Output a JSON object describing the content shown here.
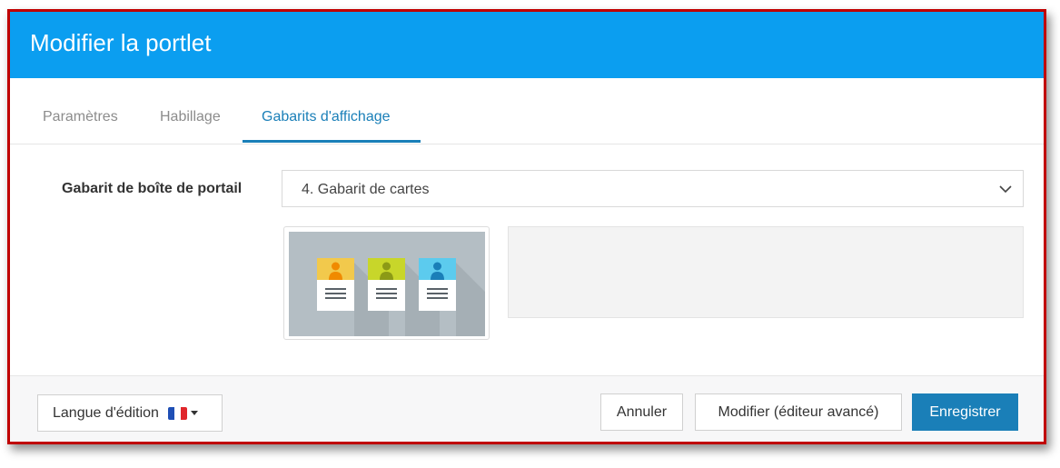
{
  "dialog": {
    "title": "Modifier la portlet"
  },
  "tabs": [
    {
      "label": "Paramètres"
    },
    {
      "label": "Habillage"
    },
    {
      "label": "Gabarits d'affichage"
    }
  ],
  "active_tab": "Gabarits d'affichage",
  "form": {
    "label": "Gabarit de boîte de portail",
    "selected": "4. Gabarit de cartes"
  },
  "footer": {
    "language_label": "Langue d'édition",
    "cancel_label": "Annuler",
    "advanced_label": "Modifier (éditeur avancé)",
    "save_label": "Enregistrer"
  },
  "colors": {
    "header": "#0b9ef0",
    "accent": "#1a7fb8",
    "frame_border": "#c00000"
  },
  "icons": {
    "dropdown": "chevron-down-icon",
    "flag": "flag-france-icon",
    "caret": "caret-down-icon"
  }
}
